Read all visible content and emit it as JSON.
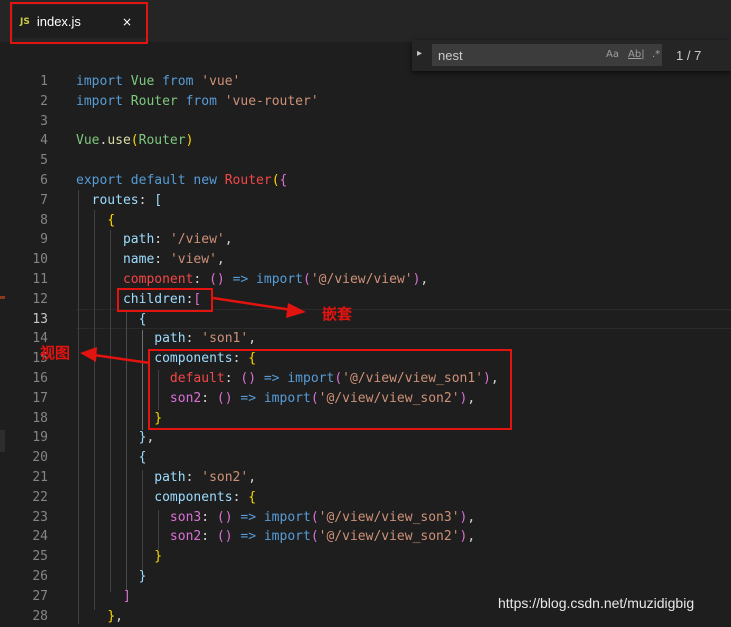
{
  "tab": {
    "icon": "JS",
    "filename": "index.js",
    "close": "×"
  },
  "find": {
    "query": "nest",
    "match_case": "Aa",
    "whole_word": "Ab|",
    "regex": ".*",
    "count": "1 / 7"
  },
  "annotations": {
    "nesting": "嵌套",
    "views": "视图"
  },
  "watermark": "https://blog.csdn.net/muzidigbig",
  "current_line": 13,
  "lines": [
    {
      "n": "1",
      "t": "import Vue from 'vue'"
    },
    {
      "n": "2",
      "t": "import Router from 'vue-router'"
    },
    {
      "n": "3",
      "t": ""
    },
    {
      "n": "4",
      "t": "Vue.use(Router)"
    },
    {
      "n": "5",
      "t": ""
    },
    {
      "n": "6",
      "t": "export default new Router({"
    },
    {
      "n": "7",
      "t": "  routes: ["
    },
    {
      "n": "8",
      "t": "    {"
    },
    {
      "n": "9",
      "t": "      path: '/view',"
    },
    {
      "n": "10",
      "t": "      name: 'view',"
    },
    {
      "n": "11",
      "t": "      component: () => import('@/view/view'),"
    },
    {
      "n": "12",
      "t": "      children:["
    },
    {
      "n": "13",
      "t": "        {"
    },
    {
      "n": "14",
      "t": "          path: 'son1',"
    },
    {
      "n": "15",
      "t": "          components: {"
    },
    {
      "n": "16",
      "t": "            default: () => import('@/view/view_son1'),"
    },
    {
      "n": "17",
      "t": "            son2: () => import('@/view/view_son2'),"
    },
    {
      "n": "18",
      "t": "          }"
    },
    {
      "n": "19",
      "t": "        },"
    },
    {
      "n": "20",
      "t": "        {"
    },
    {
      "n": "21",
      "t": "          path: 'son2',"
    },
    {
      "n": "22",
      "t": "          components: {"
    },
    {
      "n": "23",
      "t": "            son3: () => import('@/view/view_son3'),"
    },
    {
      "n": "24",
      "t": "            son2: () => import('@/view/view_son2'),"
    },
    {
      "n": "25",
      "t": "          }"
    },
    {
      "n": "26",
      "t": "        }"
    },
    {
      "n": "27",
      "t": "      ]"
    },
    {
      "n": "28",
      "t": "    },"
    }
  ]
}
